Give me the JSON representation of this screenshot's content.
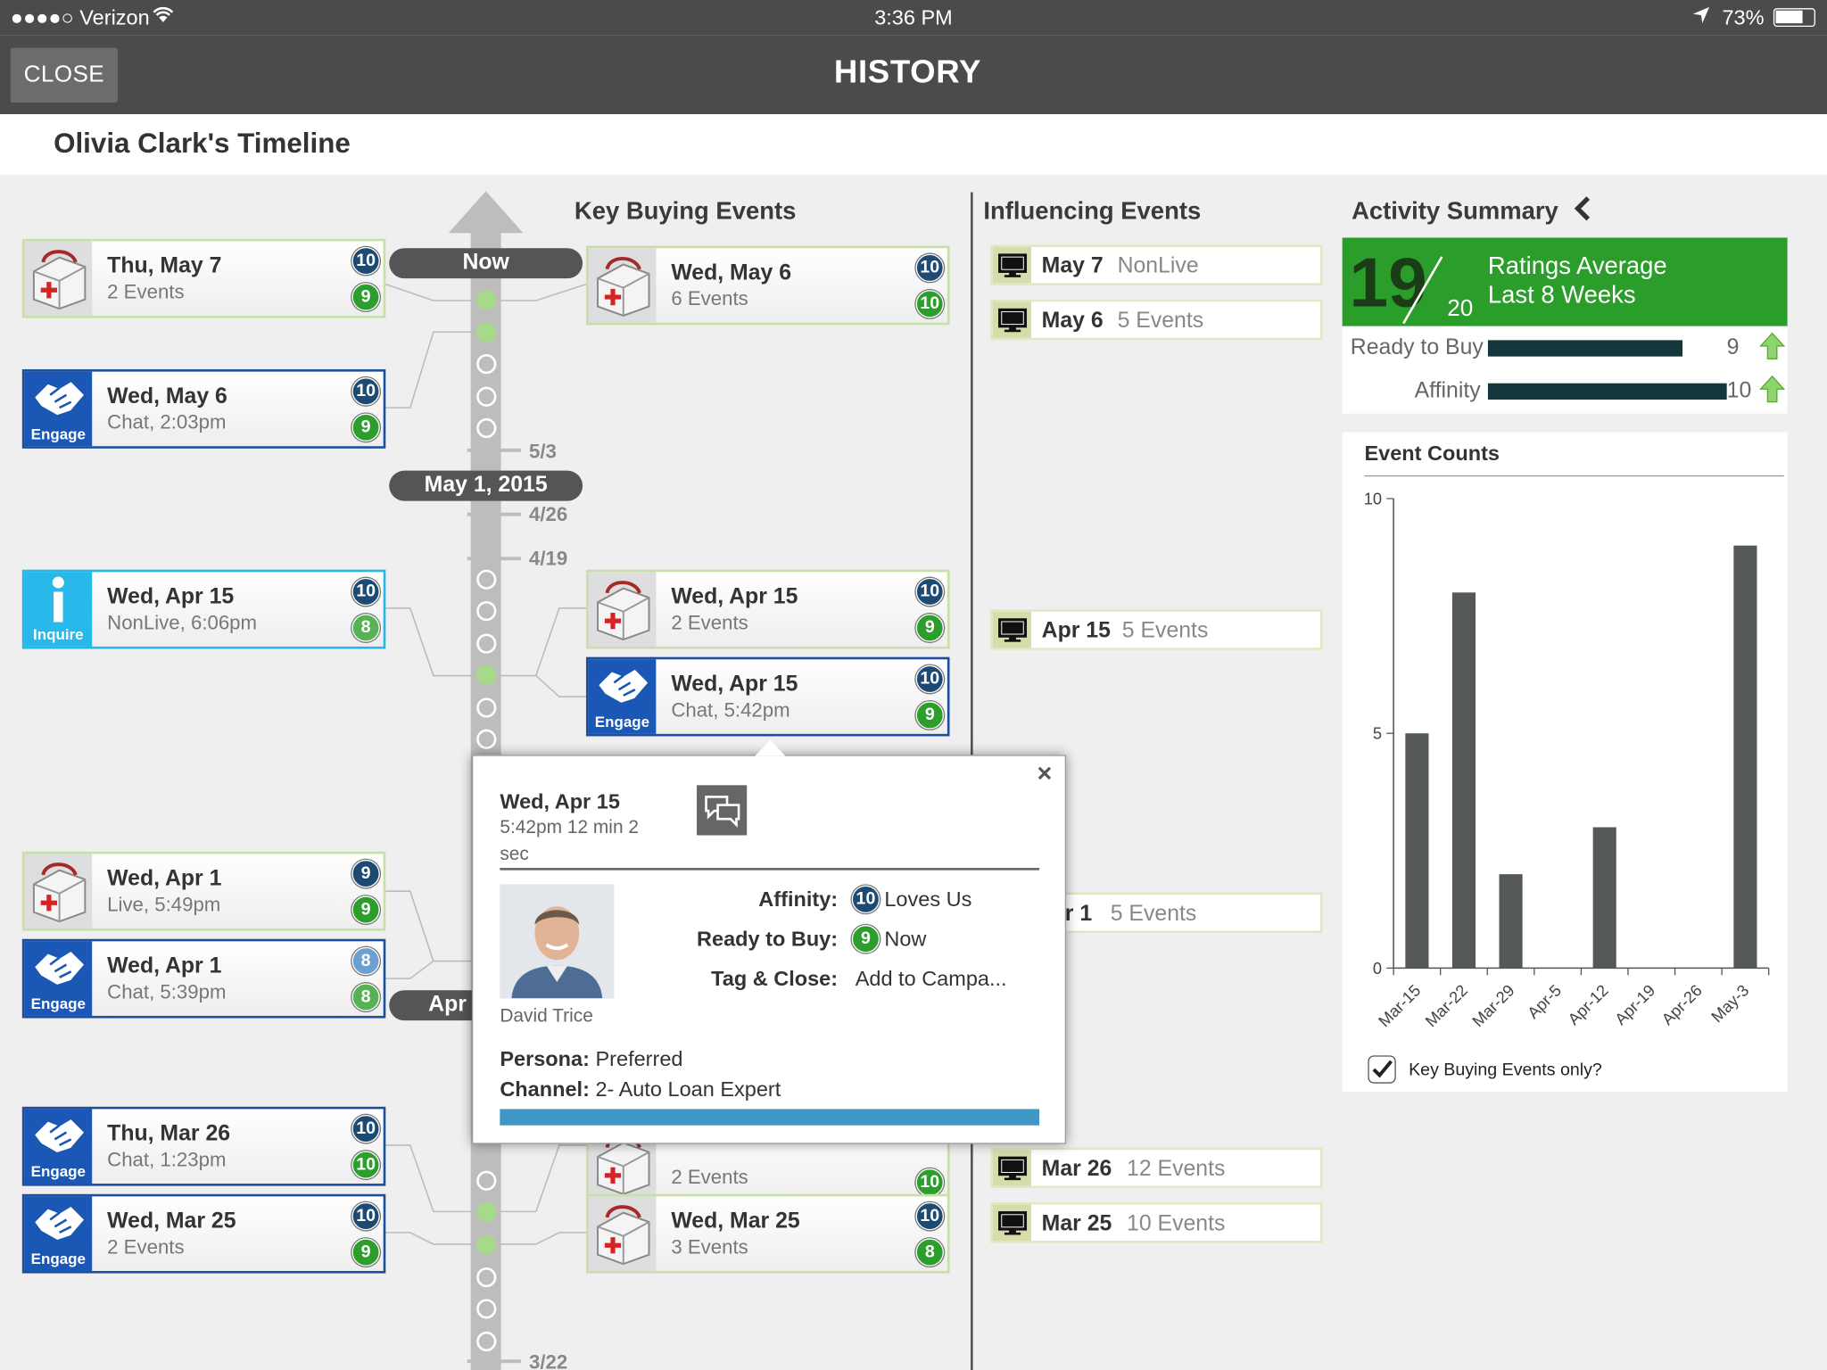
{
  "status": {
    "carrier": "●●●●○ Verizon",
    "time": "3:36 PM",
    "battery": "73%"
  },
  "header": {
    "close": "CLOSE",
    "title": "HISTORY"
  },
  "page": {
    "title": "Olivia Clark's Timeline"
  },
  "columns": {
    "key": "Key Buying Events",
    "influencing": "Influencing Events",
    "summary": "Activity Summary"
  },
  "timeline": {
    "now": "Now",
    "may1": "May 1, 2015",
    "apr": "Apr",
    "ticks": [
      "5/3",
      "4/26",
      "4/19",
      "3/22"
    ]
  },
  "left_cards": [
    {
      "icon": "kit",
      "date": "Thu, May 7",
      "detail": "2 Events",
      "b1": "10",
      "b2": "9"
    },
    {
      "icon": "engage",
      "date": "Wed, May 6",
      "detail": "Chat, 2:03pm",
      "b1": "10",
      "b2": "9"
    },
    {
      "icon": "inquire",
      "date": "Wed, Apr 15",
      "detail": "NonLive, 6:06pm",
      "b1": "10",
      "b2": "8"
    },
    {
      "icon": "kit",
      "date": "Wed, Apr 1",
      "detail": "Live, 5:49pm",
      "b1": "9",
      "b2": "9"
    },
    {
      "icon": "engage",
      "date": "Wed, Apr 1",
      "detail": "Chat, 5:39pm",
      "b1": "8",
      "b2": "8"
    },
    {
      "icon": "engage",
      "date": "Thu, Mar 26",
      "detail": "Chat, 1:23pm",
      "b1": "10",
      "b2": "10"
    },
    {
      "icon": "engage",
      "date": "Wed, Mar 25",
      "detail": "2 Events",
      "b1": "10",
      "b2": "9"
    }
  ],
  "right_cards": [
    {
      "icon": "kit",
      "date": "Wed, May 6",
      "detail": "6 Events",
      "b1": "10",
      "b2": "10"
    },
    {
      "icon": "kit",
      "date": "Wed, Apr 15",
      "detail": "2 Events",
      "b1": "10",
      "b2": "9"
    },
    {
      "icon": "engage",
      "date": "Wed, Apr 15",
      "detail": "Chat, 5:42pm",
      "b1": "10",
      "b2": "9"
    },
    {
      "icon": "kit",
      "date": "",
      "detail": "2 Events",
      "b1": "",
      "b2": "10"
    },
    {
      "icon": "kit",
      "date": "Wed, Mar 25",
      "detail": "3 Events",
      "b1": "10",
      "b2": "8"
    }
  ],
  "icon_labels": {
    "engage": "Engage",
    "inquire": "Inquire"
  },
  "influencing": [
    {
      "date": "May 7",
      "events": "NonLive"
    },
    {
      "date": "May 6",
      "events": "5 Events"
    },
    {
      "date": "Apr 15",
      "events": "5 Events"
    },
    {
      "date": "r 1",
      "events": "5 Events"
    },
    {
      "date": "Mar 26",
      "events": "12 Events"
    },
    {
      "date": "Mar 25",
      "events": "10 Events"
    }
  ],
  "summary": {
    "score": "19",
    "out_of": "20",
    "label1": "Ratings Average",
    "label2": "Last 8 Weeks",
    "ready_label": "Ready to Buy",
    "ready_value": "9",
    "ready_fraction": 0.9,
    "affinity_label": "Affinity",
    "affinity_value": "10",
    "affinity_fraction": 1.0
  },
  "counts_title": "Event Counts",
  "key_only_label": "Key Buying Events only?",
  "chart_data": {
    "type": "bar",
    "title": "Event Counts",
    "categories": [
      "Mar-15",
      "Mar-22",
      "Mar-29",
      "Apr-5",
      "Apr-12",
      "Apr-19",
      "Apr-26",
      "May-3"
    ],
    "values": [
      5,
      8,
      2,
      0,
      3,
      0,
      0,
      9
    ],
    "yticks": [
      "0",
      "5",
      "10"
    ],
    "ylim": [
      0,
      10
    ],
    "color": "#555859"
  },
  "popup": {
    "date": "Wed, Apr 15",
    "time": "5:42pm  12 min 2",
    "time2": "sec",
    "affinity_label": "Affinity:",
    "affinity_badge": "10",
    "affinity_text": "Loves Us",
    "ready_label": "Ready to Buy:",
    "ready_badge": "9",
    "ready_text": "Now",
    "tag_label": "Tag & Close:",
    "tag_text": "Add to Campa...",
    "name": "David Trice",
    "persona_label": "Persona:",
    "persona": "Preferred",
    "channel_label": "Channel:",
    "channel": "2- Auto Loan Expert",
    "close": "×"
  }
}
